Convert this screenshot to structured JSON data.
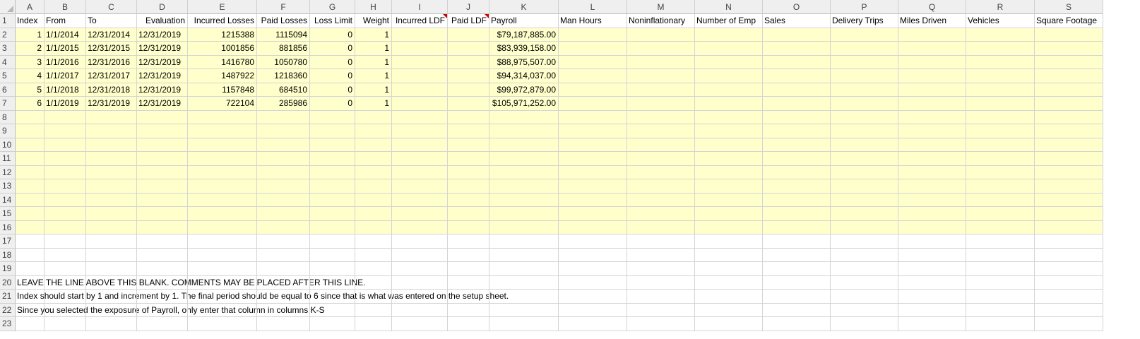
{
  "columns": [
    "A",
    "B",
    "C",
    "D",
    "E",
    "F",
    "G",
    "H",
    "I",
    "J",
    "K",
    "L",
    "M",
    "N",
    "O",
    "P",
    "Q",
    "R",
    "S"
  ],
  "header_row": [
    "Index",
    "From",
    "To",
    "Evaluation",
    "Incurred Losses",
    "Paid Losses",
    "Loss Limit",
    "Weight",
    "Incurred LDF",
    "Paid LDF",
    "Payroll",
    "Man Hours",
    "Noninflationary",
    "Number of Emp",
    "Sales",
    "Delivery Trips",
    "Miles Driven",
    "Vehicles",
    "Square Footage"
  ],
  "data_rows": [
    [
      "1",
      "1/1/2014",
      "12/31/2014",
      "12/31/2019",
      "1215388",
      "1115094",
      "0",
      "1",
      "",
      "",
      "$79,187,885.00"
    ],
    [
      "2",
      "1/1/2015",
      "12/31/2015",
      "12/31/2019",
      "1001856",
      "881856",
      "0",
      "1",
      "",
      "",
      "$83,939,158.00"
    ],
    [
      "3",
      "1/1/2016",
      "12/31/2016",
      "12/31/2019",
      "1416780",
      "1050780",
      "0",
      "1",
      "",
      "",
      "$88,975,507.00"
    ],
    [
      "4",
      "1/1/2017",
      "12/31/2017",
      "12/31/2019",
      "1487922",
      "1218360",
      "0",
      "1",
      "",
      "",
      "$94,314,037.00"
    ],
    [
      "5",
      "1/1/2018",
      "12/31/2018",
      "12/31/2019",
      "1157848",
      "684510",
      "0",
      "1",
      "",
      "",
      "$99,972,879.00"
    ],
    [
      "6",
      "1/1/2019",
      "12/31/2019",
      "12/31/2019",
      "722104",
      "285986",
      "0",
      "1",
      "",
      "",
      "$105,971,252.00"
    ]
  ],
  "comment_rows": {
    "20": "LEAVE THE LINE ABOVE THIS BLANK. COMMENTS MAY BE PLACED AFTER THIS LINE.",
    "21": "Index should start by 1 and increment by 1. The final period should be equal to 6 since that is what was entered on the setup sheet.",
    "22": "Since you selected the exposure of Payroll, only enter that column in columns K-S"
  },
  "row_numbers": [
    "1",
    "2",
    "3",
    "4",
    "5",
    "6",
    "7",
    "8",
    "9",
    "10",
    "11",
    "12",
    "13",
    "14",
    "15",
    "16",
    "17",
    "18",
    "19",
    "20",
    "21",
    "22",
    "23"
  ],
  "colors": {
    "input_fill": "#ffffcc",
    "header_fill": "#efefef",
    "gridline": "#d4d4d4",
    "comment_flag": "#d40000"
  }
}
